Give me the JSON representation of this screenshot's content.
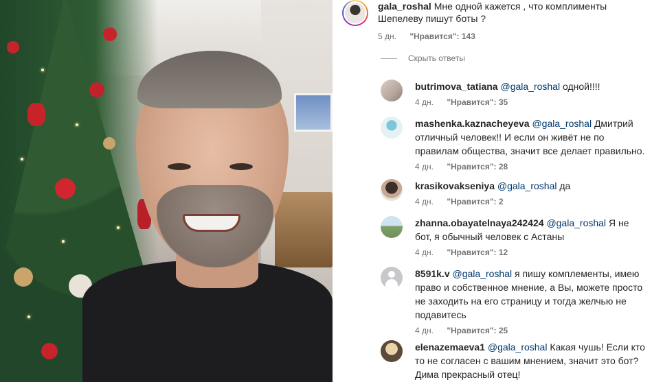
{
  "main_comment": {
    "username": "gala_roshal",
    "text": "Мне одной кажется , что комплименты Шепелеву пишут боты ?",
    "time": "5 дн.",
    "likes": "\"Нравится\": 143"
  },
  "hide_replies_label": "Скрыть ответы",
  "replies": [
    {
      "username": "butrimova_tatiana",
      "mention": "@gala_roshal",
      "text": "одной!!!!",
      "time": "4 дн.",
      "likes": "\"Нравится\": 35"
    },
    {
      "username": "mashenka.kaznacheyeva",
      "mention": "@gala_roshal",
      "text": "Дмитрий отличный человек!! И если он живёт не по правилам общества, значит все делает правильно.",
      "time": "4 дн.",
      "likes": "\"Нравится\": 28"
    },
    {
      "username": "krasikovakseniya",
      "mention": "@gala_roshal",
      "text": "да",
      "time": "4 дн.",
      "likes": "\"Нравится\": 2"
    },
    {
      "username": "zhanna.obayatelnaya242424",
      "mention": "@gala_roshal",
      "text": "Я не бот, я обычный человек с Астаны",
      "time": "4 дн.",
      "likes": "\"Нравится\": 12"
    },
    {
      "username": "8591k.v",
      "mention": "@gala_roshal",
      "text": "я пишу комплементы, имею право и собственное мнение, а Вы, можете просто не заходить на его страницу и тогда желчью не подавитесь",
      "time": "4 дн.",
      "likes": "\"Нравится\": 25"
    },
    {
      "username": "elenazemaeva1",
      "mention": "@gala_roshal",
      "text": "Какая чушь! Если кто то не согласен с вашим мнением, значит это бот? Дима прекрасный отец!",
      "time": "",
      "likes": ""
    }
  ]
}
